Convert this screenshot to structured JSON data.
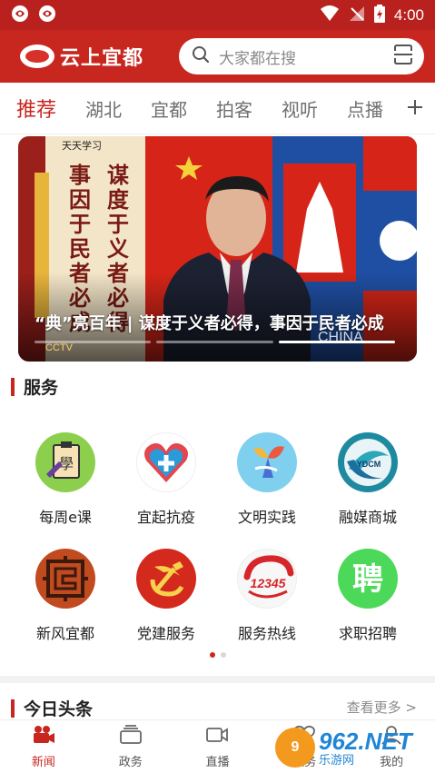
{
  "status_bar": {
    "time": "4:00"
  },
  "header": {
    "app_title": "云上宜都",
    "search_placeholder": "大家都在搜"
  },
  "tabs": [
    {
      "label": "推荐",
      "active": true
    },
    {
      "label": "湖北"
    },
    {
      "label": "宜都"
    },
    {
      "label": "拍客"
    },
    {
      "label": "视听"
    },
    {
      "label": "点播"
    }
  ],
  "banner": {
    "caption": "“典”亮百年 | 谋度于义者必得，事因于民者必成",
    "calligraphy_left": "事因于民者必成",
    "calligraphy_right": "谋度于义者必得",
    "scroll_header": "天天学习",
    "tv_logo": "CCTV",
    "desk_sign": "CHINA"
  },
  "services_section": {
    "title": "服务",
    "items": [
      {
        "label": "每周e课",
        "icon": "clipboard-learn-icon",
        "glyph": "學"
      },
      {
        "label": "宜起抗疫",
        "icon": "heart-cross-icon"
      },
      {
        "label": "文明实践",
        "icon": "civilization-practice-icon"
      },
      {
        "label": "融媒商城",
        "icon": "ydcm-mall-icon",
        "glyph": "YDCM"
      },
      {
        "label": "新风宜都",
        "icon": "pattern-seal-icon"
      },
      {
        "label": "党建服务",
        "icon": "hammer-sickle-icon"
      },
      {
        "label": "服务热线",
        "icon": "hotline-12345-icon",
        "glyph": "12345"
      },
      {
        "label": "求职招聘",
        "icon": "recruit-icon",
        "glyph": "聘"
      }
    ],
    "pages": 2,
    "current_page": 1
  },
  "headlines_section": {
    "title": "今日头条",
    "more": "查看更多 >"
  },
  "bottom_nav": [
    {
      "label": "新闻",
      "icon": "news-camera-icon",
      "active": true
    },
    {
      "label": "政务",
      "icon": "government-icon"
    },
    {
      "label": "直播",
      "icon": "live-video-icon"
    },
    {
      "label": "服务",
      "icon": "service-heart-icon"
    },
    {
      "label": "我的",
      "icon": "profile-icon"
    }
  ],
  "watermark": {
    "number": "962.NET",
    "sub": "乐游网"
  },
  "colors": {
    "brand_red": "#c8271f",
    "status_red": "#b8211e"
  }
}
